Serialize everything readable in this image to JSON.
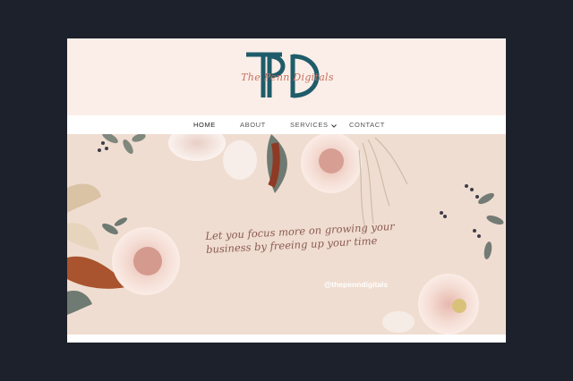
{
  "brand": {
    "monogram": "TPD",
    "script_name": "The Penn Digitals",
    "colors": {
      "teal": "#1f5c6a",
      "rose": "#c7705f",
      "cream": "#fbeee8"
    }
  },
  "nav": {
    "items": [
      {
        "label": "HOME",
        "active": true
      },
      {
        "label": "ABOUT",
        "active": false
      },
      {
        "label": "SERVICES",
        "active": false,
        "has_dropdown": true
      },
      {
        "label": "CONTACT",
        "active": false
      }
    ]
  },
  "hero": {
    "tagline_line1": "Let you focus more  on growing your",
    "tagline_line2": "business by freeing up your time",
    "handle": "@thepenndigitals"
  },
  "icons": {
    "services_dropdown": "chevron-down-icon"
  }
}
